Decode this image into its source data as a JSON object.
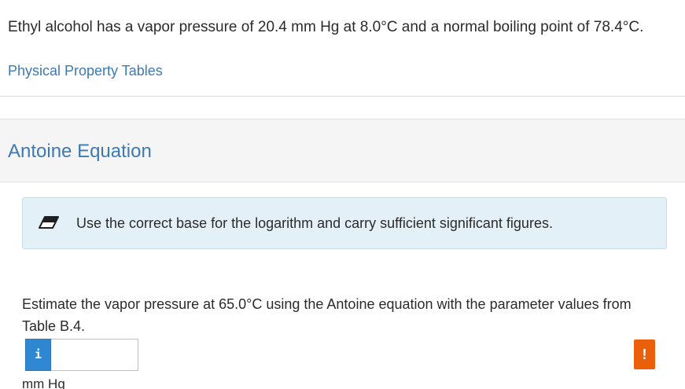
{
  "problem": {
    "intro": "Ethyl alcohol has a vapor pressure of 20.4 mm Hg at 8.0°C and a normal boiling point of 78.4°C.",
    "link_label": "Physical Property Tables"
  },
  "section": {
    "title": "Antoine Equation"
  },
  "hint": {
    "icon": "eraser-icon",
    "text": "Use the correct base for the logarithm and carry sufficient significant figures."
  },
  "question": {
    "text": "Estimate the vapor pressure at 65.0°C using the Antoine equation with the parameter values from Table B.4.",
    "info_glyph": "i",
    "answer_value": "",
    "unit": "mm Hg",
    "alert_glyph": "!"
  },
  "colors": {
    "link": "#3d7ab3",
    "hint_bg": "#e4f0f8",
    "info_button": "#2f86d1",
    "alert_button": "#ec5f0a"
  }
}
